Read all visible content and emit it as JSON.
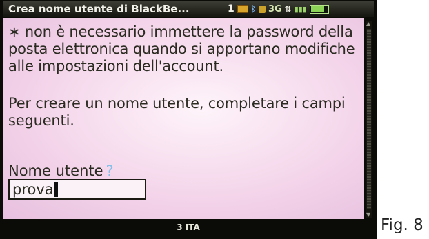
{
  "app": {
    "title": "Crea nome utente di BlackBe...",
    "status": {
      "notification_count": "1",
      "network_type": "3G",
      "battery_level": 0.8,
      "icons": [
        "email-icon",
        "bluetooth-icon",
        "lock-icon",
        "data-arrows-icon",
        "signal-icon",
        "battery-icon"
      ]
    }
  },
  "content": {
    "note": "∗ non è necessario immettere la password della posta elettronica quando si apportano modifiche alle impostazioni dell'account.",
    "instruction": "Per creare un nome utente, completare i campi seguenti.",
    "username_label": "Nome utente",
    "help_symbol": "?",
    "username_value": "prova"
  },
  "footer": {
    "input_mode": "3 ITA"
  },
  "caption": "Fig. 8"
}
